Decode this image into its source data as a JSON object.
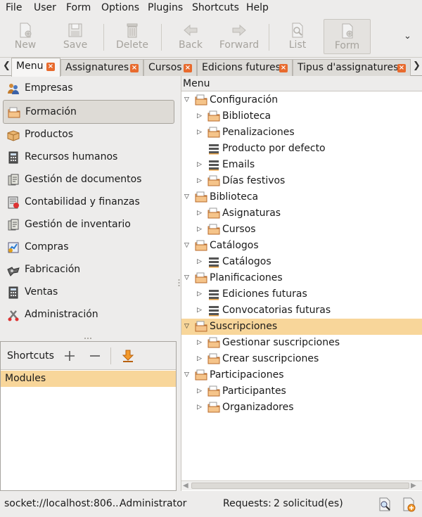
{
  "menubar": [
    "File",
    "User",
    "Form",
    "Options",
    "Plugins",
    "Shortcuts",
    "Help"
  ],
  "toolbar": {
    "new": "New",
    "save": "Save",
    "delete": "Delete",
    "back": "Back",
    "forward": "Forward",
    "list": "List",
    "form": "Form"
  },
  "tabs": [
    "Menu",
    "Assignatures",
    "Cursos",
    "Edicions futures",
    "Tipus d'assignatures"
  ],
  "modules": [
    {
      "label": "Empresas",
      "icon": "people-icon"
    },
    {
      "label": "Formación",
      "icon": "folder-icon"
    },
    {
      "label": "Productos",
      "icon": "box-icon"
    },
    {
      "label": "Recursos humanos",
      "icon": "calculator-icon"
    },
    {
      "label": "Gestión de documentos",
      "icon": "documents-icon"
    },
    {
      "label": "Contabilidad y finanzas",
      "icon": "ledger-icon"
    },
    {
      "label": "Gestión de inventario",
      "icon": "inventory-icon"
    },
    {
      "label": "Compras",
      "icon": "purchase-icon"
    },
    {
      "label": "Fabricación",
      "icon": "factory-icon"
    },
    {
      "label": "Ventas",
      "icon": "calculator-icon"
    },
    {
      "label": "Administración",
      "icon": "tools-icon"
    }
  ],
  "selected_module": "Formación",
  "shortcuts": {
    "title": "Shortcuts",
    "rows": [
      "Modules"
    ]
  },
  "tree": {
    "header": "Menu",
    "rows": [
      {
        "label": "Configuración",
        "level": 0,
        "expanded": true,
        "icon": "folder"
      },
      {
        "label": "Biblioteca",
        "level": 1,
        "expanded": false,
        "icon": "folder"
      },
      {
        "label": "Penalizaciones",
        "level": 1,
        "expanded": false,
        "icon": "folder"
      },
      {
        "label": "Producto por defecto",
        "level": 1,
        "expanded": null,
        "icon": "list"
      },
      {
        "label": "Emails",
        "level": 1,
        "expanded": false,
        "icon": "list"
      },
      {
        "label": "Días festivos",
        "level": 1,
        "expanded": false,
        "icon": "folder"
      },
      {
        "label": "Biblioteca",
        "level": 0,
        "expanded": true,
        "icon": "folder"
      },
      {
        "label": "Asignaturas",
        "level": 1,
        "expanded": false,
        "icon": "folder"
      },
      {
        "label": "Cursos",
        "level": 1,
        "expanded": false,
        "icon": "folder"
      },
      {
        "label": "Catálogos",
        "level": 0,
        "expanded": true,
        "icon": "folder"
      },
      {
        "label": "Catálogos",
        "level": 1,
        "expanded": false,
        "icon": "list"
      },
      {
        "label": "Planificaciones",
        "level": 0,
        "expanded": true,
        "icon": "folder"
      },
      {
        "label": "Ediciones futuras",
        "level": 1,
        "expanded": false,
        "icon": "list"
      },
      {
        "label": "Convocatorias futuras",
        "level": 1,
        "expanded": false,
        "icon": "list"
      },
      {
        "label": "Suscripciones",
        "level": 0,
        "expanded": true,
        "icon": "folder",
        "selected": true
      },
      {
        "label": "Gestionar suscripciones",
        "level": 1,
        "expanded": false,
        "icon": "folder"
      },
      {
        "label": "Crear suscripciones",
        "level": 1,
        "expanded": false,
        "icon": "folder"
      },
      {
        "label": "Participaciones",
        "level": 0,
        "expanded": true,
        "icon": "folder"
      },
      {
        "label": "Participantes",
        "level": 1,
        "expanded": false,
        "icon": "folder"
      },
      {
        "label": "Organizadores",
        "level": 1,
        "expanded": false,
        "icon": "folder"
      }
    ]
  },
  "status": {
    "connection": "socket://localhost:806...",
    "user": "Administrator",
    "requests_label": "Requests:",
    "requests_value": "2 solicitud(es)"
  },
  "colors": {
    "selection": "#f8d69a",
    "accent": "#e86a2d",
    "background": "#edeceb"
  }
}
